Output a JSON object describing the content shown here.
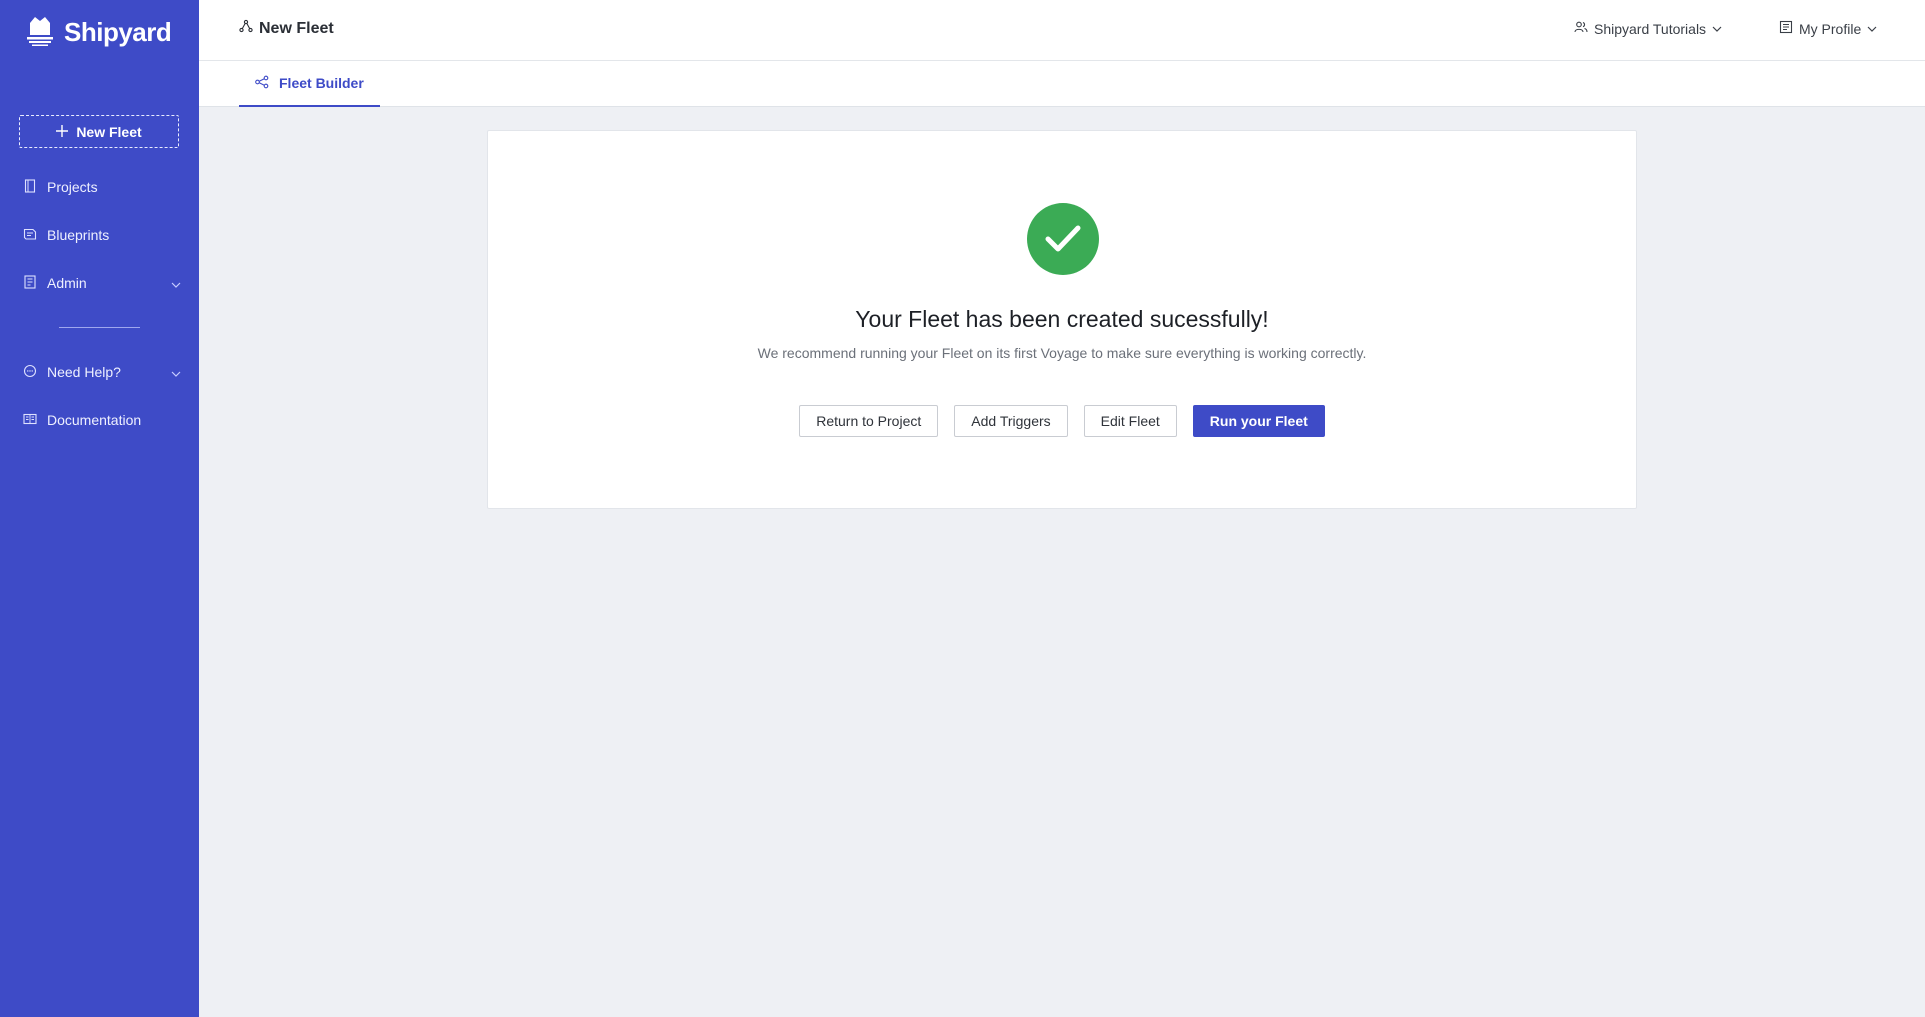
{
  "sidebar": {
    "brand": "Shipyard",
    "new_fleet_label": "New Fleet",
    "items": [
      {
        "label": "Projects",
        "icon": "document-icon"
      },
      {
        "label": "Blueprints",
        "icon": "blueprint-icon"
      },
      {
        "label": "Admin",
        "icon": "admin-icon",
        "expandable": true
      }
    ],
    "help_items": [
      {
        "label": "Need Help?",
        "icon": "chat-icon",
        "expandable": true
      },
      {
        "label": "Documentation",
        "icon": "book-icon"
      }
    ]
  },
  "header": {
    "title": "New Fleet",
    "org_menu": "Shipyard Tutorials",
    "profile_menu": "My Profile"
  },
  "tabs": [
    {
      "label": "Fleet Builder",
      "active": true
    }
  ],
  "success": {
    "headline": "Your Fleet has been created sucessfully!",
    "message": "We recommend running your Fleet on its first Voyage to make sure everything is working correctly.",
    "buttons": {
      "return": "Return to Project",
      "triggers": "Add Triggers",
      "edit": "Edit Fleet",
      "run": "Run your Fleet"
    }
  },
  "colors": {
    "sidebar": "#3e4bc7",
    "accent": "#3e4bc7",
    "success": "#3bab55",
    "background": "#eef0f4"
  }
}
